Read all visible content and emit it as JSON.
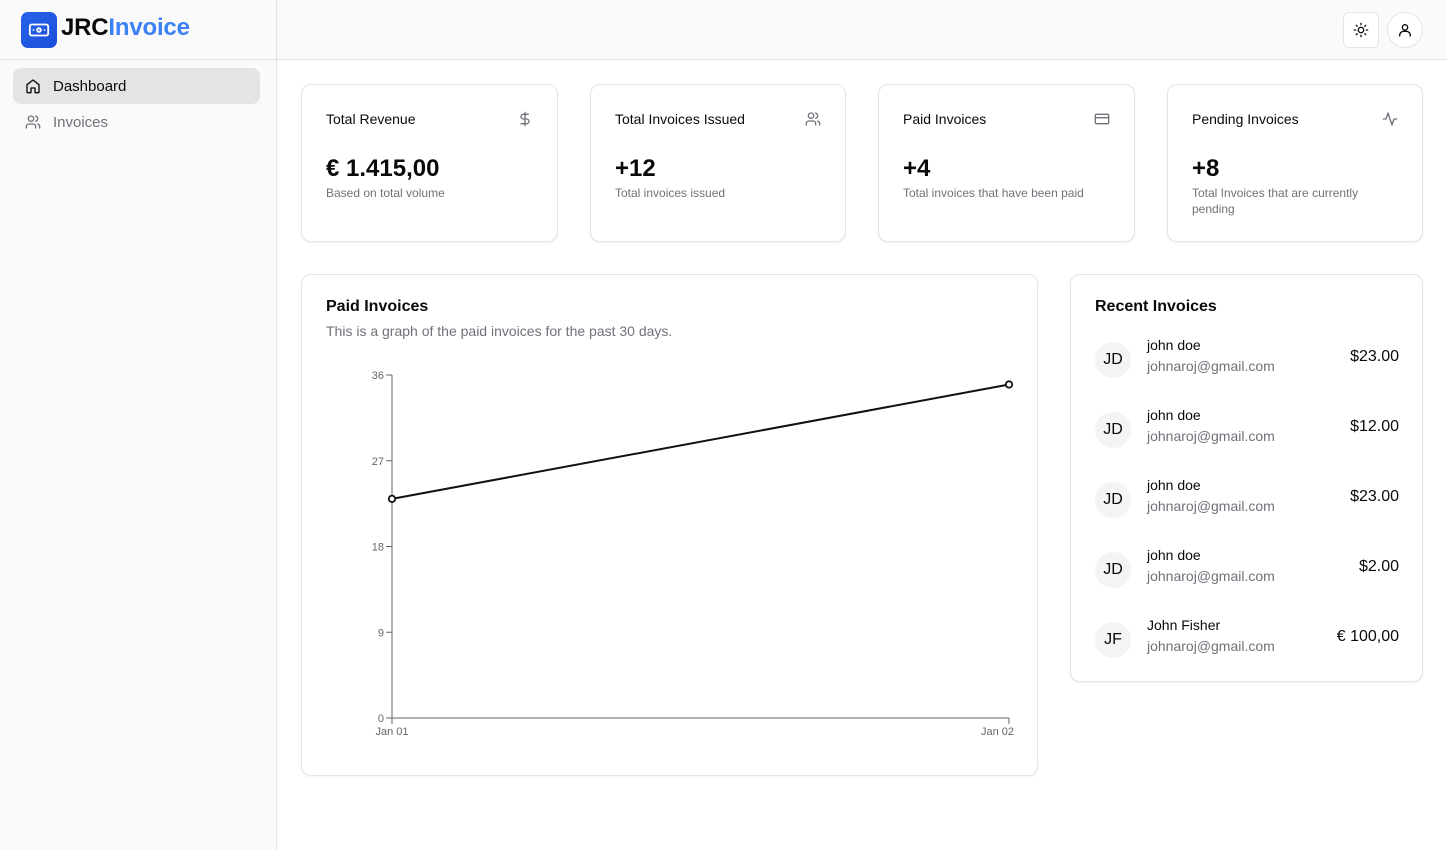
{
  "brand": {
    "part1": "JRC",
    "part2": "Invoice"
  },
  "nav": [
    {
      "label": "Dashboard",
      "icon": "home-icon",
      "active": true
    },
    {
      "label": "Invoices",
      "icon": "users-icon",
      "active": false
    }
  ],
  "topbar": {
    "theme_icon": "sun-icon",
    "user_icon": "user-icon"
  },
  "stats": [
    {
      "title": "Total Revenue",
      "icon": "dollar-icon",
      "value": "€ 1.415,00",
      "sub": "Based on total volume"
    },
    {
      "title": "Total Invoices Issued",
      "icon": "users-icon",
      "value": "+12",
      "sub": "Total invoices issued"
    },
    {
      "title": "Paid Invoices",
      "icon": "credit-card-icon",
      "value": "+4",
      "sub": "Total invoices that have been paid"
    },
    {
      "title": "Pending Invoices",
      "icon": "activity-icon",
      "value": "+8",
      "sub": "Total Invoices that are currently pending"
    }
  ],
  "chart_panel": {
    "title": "Paid Invoices",
    "description": "This is a graph of the paid invoices for the past 30 days."
  },
  "chart_data": {
    "type": "line",
    "x": [
      "Jan 01",
      "Jan 02"
    ],
    "series": [
      {
        "values": [
          23,
          35
        ]
      }
    ],
    "yticks": [
      0,
      9,
      18,
      27,
      36
    ],
    "ylim": [
      0,
      36
    ],
    "xlabel": "",
    "ylabel": "",
    "grid": false,
    "line_color": "#111111"
  },
  "recent": {
    "title": "Recent Invoices",
    "items": [
      {
        "initials": "JD",
        "name": "john doe",
        "email": "johnaroj@gmail.com",
        "amount": "$23.00"
      },
      {
        "initials": "JD",
        "name": "john doe",
        "email": "johnaroj@gmail.com",
        "amount": "$12.00"
      },
      {
        "initials": "JD",
        "name": "john doe",
        "email": "johnaroj@gmail.com",
        "amount": "$23.00"
      },
      {
        "initials": "JD",
        "name": "john doe",
        "email": "johnaroj@gmail.com",
        "amount": "$2.00"
      },
      {
        "initials": "JF",
        "name": "John Fisher",
        "email": "johnaroj@gmail.com",
        "amount": "€ 100,00"
      }
    ]
  },
  "colors": {
    "brand_blue": "#3b82f6",
    "border": "#e4e4e7",
    "muted": "#71717a"
  }
}
